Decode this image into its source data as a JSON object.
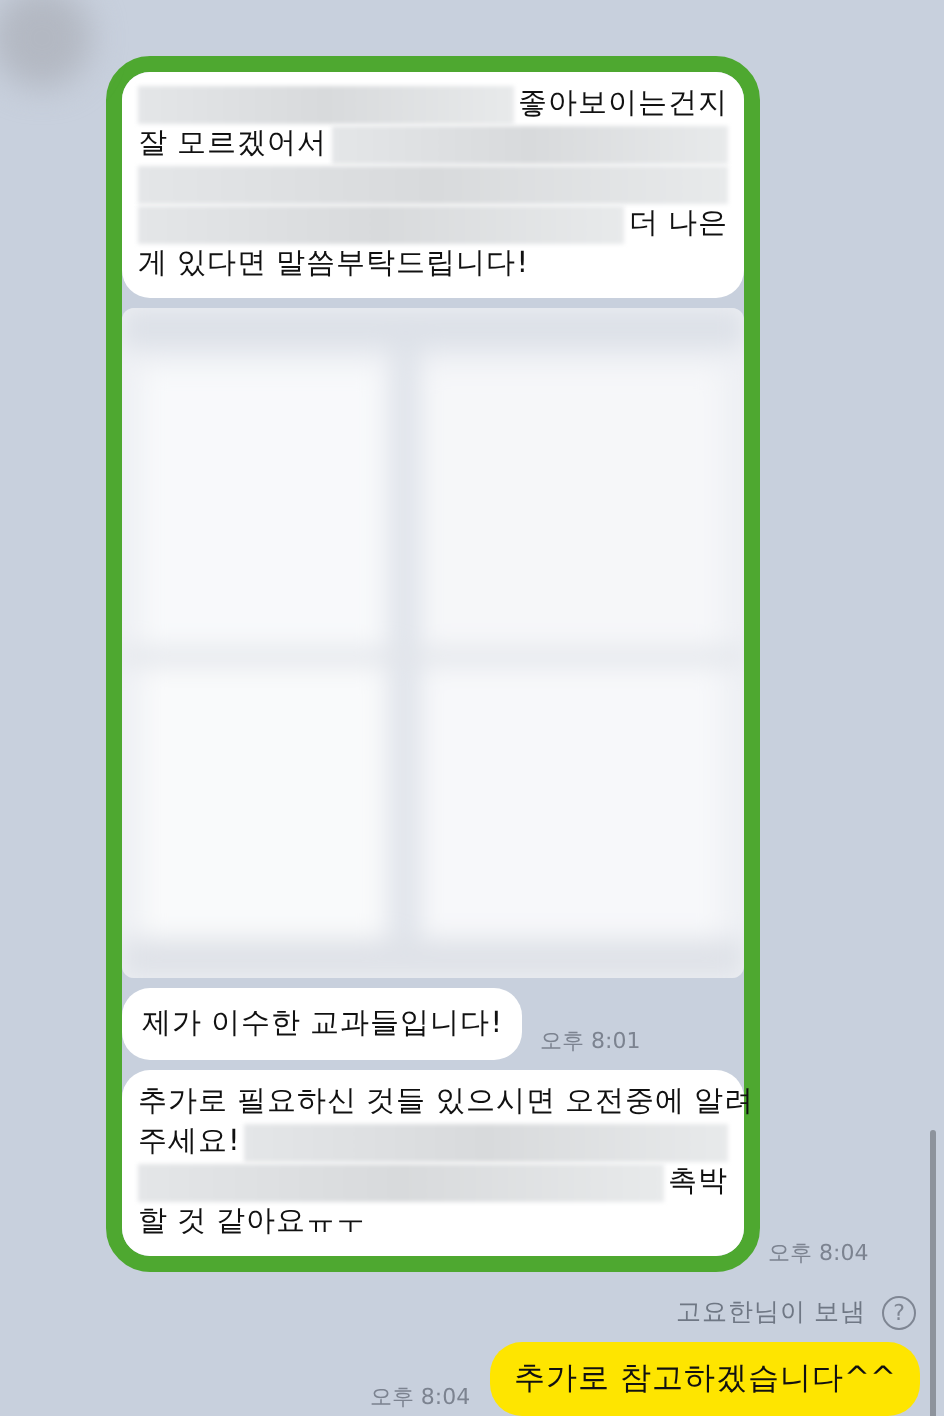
{
  "highlighted_messages": [
    {
      "kind": "text",
      "lines": [
        [
          {
            "kind": "redacted"
          },
          {
            "kind": "text",
            "text": "좋아보이는건지"
          }
        ],
        [
          {
            "kind": "text",
            "text": "잘 모르겠어서"
          },
          {
            "kind": "redacted"
          }
        ],
        [
          {
            "kind": "redacted"
          }
        ],
        [
          {
            "kind": "redacted"
          },
          {
            "kind": "text",
            "text": "더 나은"
          }
        ],
        [
          {
            "kind": "text",
            "text": "게 있다면 말씀부탁드립니다!"
          }
        ]
      ]
    },
    {
      "kind": "picture"
    },
    {
      "kind": "text",
      "time": "오후 8:01",
      "lines": [
        [
          {
            "kind": "text",
            "text": "제가 이수한 교과들입니다!"
          }
        ]
      ]
    },
    {
      "kind": "text",
      "lines": [
        [
          {
            "kind": "text",
            "text": "추가로 필요하신 것들 있으시면 오전중에 알려"
          }
        ],
        [
          {
            "kind": "text",
            "text": "주세요!"
          },
          {
            "kind": "redacted"
          }
        ],
        [
          {
            "kind": "redacted"
          },
          {
            "kind": "text",
            "text": "촉박"
          }
        ],
        [
          {
            "kind": "text",
            "text": "할 것 같아요ㅠㅜ"
          }
        ]
      ]
    }
  ],
  "highlight_time": "오후 8:04",
  "sender_note": "고요한님이 보냄",
  "help_icon": "?",
  "outgoing": {
    "text": "추가로 참고하겠습니다^^",
    "time": "오후 8:04"
  }
}
